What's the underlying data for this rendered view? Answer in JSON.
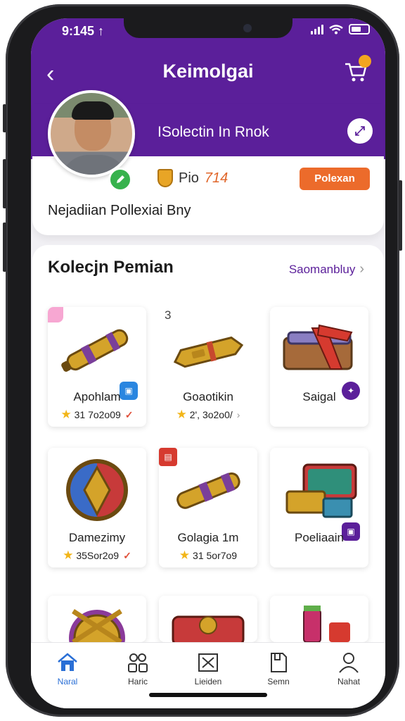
{
  "status": {
    "time": "9:145 ↑"
  },
  "header": {
    "title": "Keimolgai",
    "cart_badge": ""
  },
  "profile": {
    "collection_label": "ISolectin In Rnok",
    "points_prefix": "Pio",
    "points_value": "714",
    "action_button": "Polexan",
    "bio": "Nejadiian Pollexiai Bny"
  },
  "collection": {
    "title": "Kolecjn Pemian",
    "see_all": "Saomanbluy",
    "items": [
      {
        "name": "Apohlam",
        "meta": "31 7o2o09",
        "flag": "check",
        "icon": "golden-scroll-icon"
      },
      {
        "name": "Goaotikin",
        "meta": "2', 3o2o0/",
        "flag": "arrow",
        "icon": "golden-bar-icon"
      },
      {
        "name": "Saigal",
        "meta": "",
        "flag": "",
        "icon": "book-bundle-icon"
      },
      {
        "name": "Damezimy",
        "meta": "35Sor2o9",
        "flag": "check",
        "icon": "emblem-shield-icon"
      },
      {
        "name": "Golagia 1m",
        "meta": "31 5or7o9",
        "flag": "",
        "icon": "golden-scroll-icon"
      },
      {
        "name": "Poeliaain",
        "meta": "",
        "flag": "",
        "icon": "treasure-chest-icon"
      }
    ],
    "corner_label": "3"
  },
  "tabs": [
    {
      "label": "Naral",
      "icon": "home-icon",
      "active": true
    },
    {
      "label": "Haric",
      "icon": "users-icon",
      "active": false
    },
    {
      "label": "Lieiden",
      "icon": "box-icon",
      "active": false
    },
    {
      "label": "Semn",
      "icon": "document-icon",
      "active": false
    },
    {
      "label": "Nahat",
      "icon": "user-icon",
      "active": false
    }
  ],
  "colors": {
    "brand": "#5b1f9a",
    "accent": "#ec6b2b",
    "active_tab": "#2a6fd6"
  }
}
